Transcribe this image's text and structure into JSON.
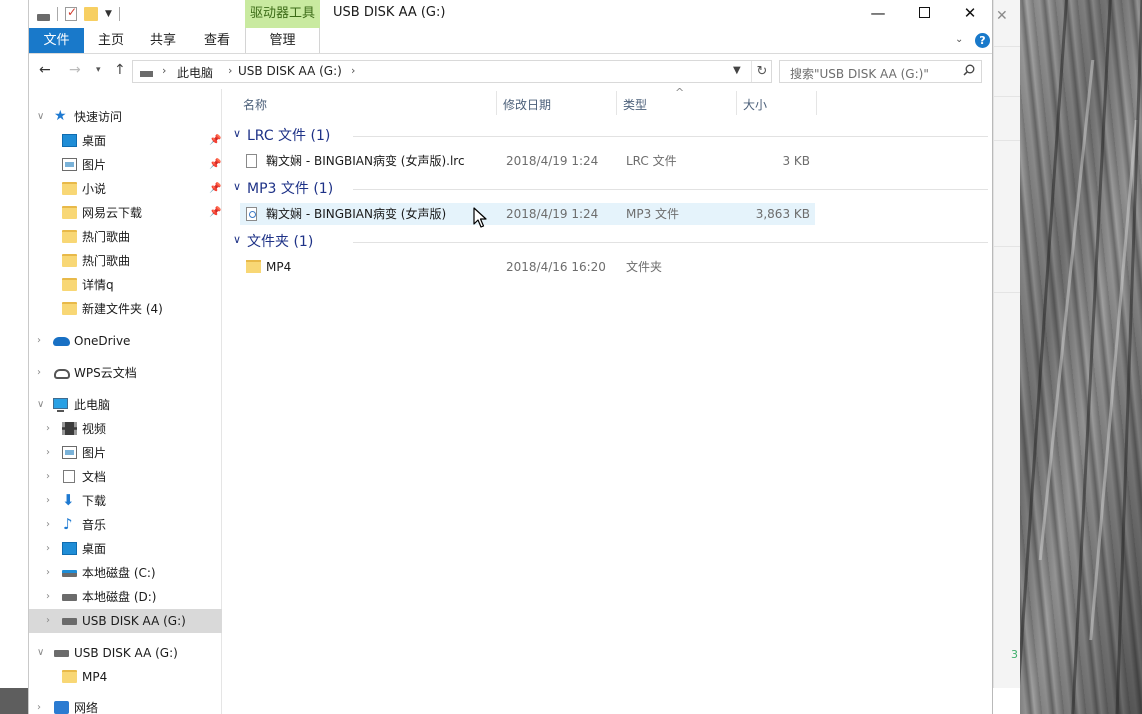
{
  "window": {
    "title": "USB DISK AA (G:)",
    "context_tab_header": "驱动器工具"
  },
  "ribbon": {
    "tabs": [
      "文件",
      "主页",
      "共享",
      "查看",
      "管理"
    ]
  },
  "address": {
    "crumbs": [
      "此电脑",
      "USB DISK AA (G:)"
    ],
    "search_placeholder": "搜索\"USB DISK AA (G:)\""
  },
  "nav": {
    "quick_access": "快速访问",
    "quick_items": [
      "桌面",
      "图片",
      "小说",
      "网易云下载",
      "热门歌曲",
      "热门歌曲",
      "详情q",
      "新建文件夹 (4)"
    ],
    "onedrive": "OneDrive",
    "wps": "WPS云文档",
    "this_pc": "此电脑",
    "pc_items": [
      "视频",
      "图片",
      "文档",
      "下载",
      "音乐",
      "桌面",
      "本地磁盘 (C:)",
      "本地磁盘 (D:)",
      "USB DISK AA (G:)"
    ],
    "usb_root": "USB DISK AA (G:)",
    "usb_child": "MP4",
    "network": "网络"
  },
  "columns": {
    "name": "名称",
    "date": "修改日期",
    "type": "类型",
    "size": "大小"
  },
  "groups": [
    {
      "title": "LRC 文件 (1)",
      "files": [
        {
          "name": "鞠文娴 - BINGBIAN病变 (女声版).lrc",
          "date": "2018/4/19 1:24",
          "type": "LRC 文件",
          "size": "3 KB",
          "icon": "document-icon"
        }
      ]
    },
    {
      "title": "MP3 文件 (1)",
      "files": [
        {
          "name": "鞠文娴 - BINGBIAN病变 (女声版)",
          "date": "2018/4/19 1:24",
          "type": "MP3 文件",
          "size": "3,863 KB",
          "icon": "audio-file-icon"
        }
      ]
    },
    {
      "title": "文件夹 (1)",
      "files": [
        {
          "name": "MP4",
          "date": "2018/4/16 16:20",
          "type": "文件夹",
          "size": "",
          "icon": "folder-icon"
        }
      ]
    }
  ],
  "colors": {
    "file_tab": "#1979ca",
    "context_tab": "#c9eaa0",
    "group_title": "#1e3287",
    "row_hover": "#e5f3fb",
    "nav_selected": "#d9d9d9"
  }
}
